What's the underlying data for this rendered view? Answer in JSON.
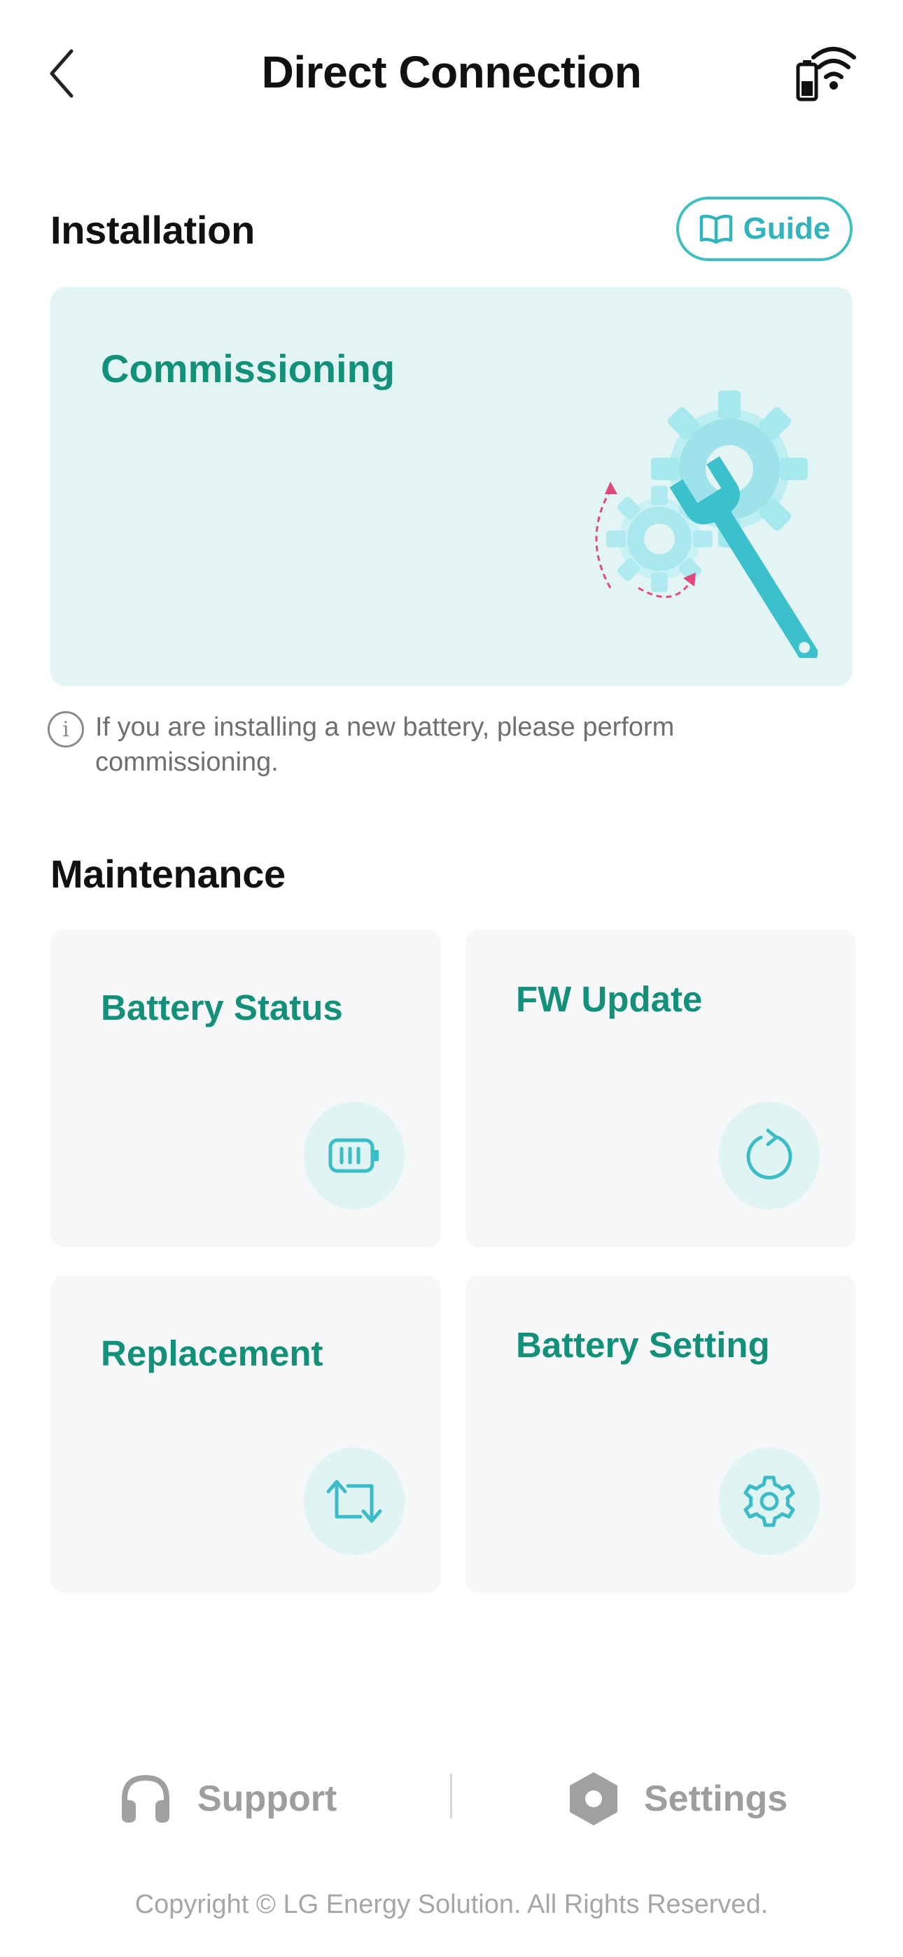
{
  "header": {
    "title": "Direct Connection",
    "back_icon": "chevron-left-icon",
    "connection_icon": "battery-wifi-icon"
  },
  "installation": {
    "title": "Installation",
    "guide_label": "Guide",
    "guide_icon": "book-icon",
    "card_title": "Commissioning",
    "card_art": "gears-wrench-illustration",
    "info_icon": "info-icon",
    "info_text": "If you are installing a new battery, please perform commissioning."
  },
  "maintenance": {
    "title": "Maintenance",
    "cards": [
      {
        "title": "Battery Status",
        "icon": "battery-icon"
      },
      {
        "title": "FW Update",
        "icon": "refresh-icon"
      },
      {
        "title": "Replacement",
        "icon": "swap-arrows-icon"
      },
      {
        "title": "Battery Setting",
        "icon": "gear-icon"
      }
    ]
  },
  "footer": {
    "support_label": "Support",
    "support_icon": "headphones-icon",
    "settings_label": "Settings",
    "settings_icon": "hexagon-settings-icon",
    "copyright": "Copyright © LG Energy Solution. All Rights Reserved."
  },
  "colors": {
    "accent": "#13907a",
    "teal": "#3fbfbf",
    "hero_bg": "#e3f4f4",
    "card_bg": "#f6f7f9",
    "icon_bg": "#e0f4f3",
    "muted": "#9e9e9e"
  }
}
